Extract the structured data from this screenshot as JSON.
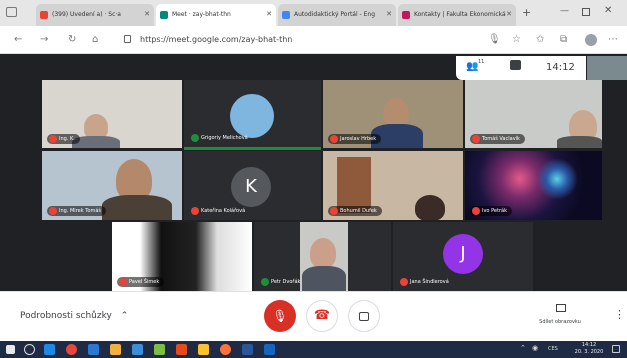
{
  "browser": {
    "tabs": [
      {
        "label": "(399) Uvedení a) · Sc·a",
        "color": "#e94335"
      },
      {
        "label": "Meet · zay-bhat-thn",
        "color": "#00897b"
      },
      {
        "label": "Autodidaktický Portál - Eng",
        "color": "#4285f4"
      },
      {
        "label": "Kontakty | Fakulta Ekonomická",
        "color": "#c2185b"
      }
    ],
    "url": "https://meet.google.com/zay-bhat-thn"
  },
  "meet": {
    "participant_count": "11",
    "clock": "14:12",
    "tiles": [
      {
        "label": "Ing. K."
      },
      {
        "label": "Grigoriy Melichová"
      },
      {
        "label": "Jaroslav Hrbek"
      },
      {
        "label": "Tomáš Vaclavík"
      },
      {
        "label": "Ing. Mirek Tomáš"
      },
      {
        "label": "Kateřina Kolářová",
        "initial": "K"
      },
      {
        "label": "Bohumil Dufek"
      },
      {
        "label": "Ivo Petrák"
      },
      {
        "label": "Pavel Šimek"
      },
      {
        "label": "Petr Dvořák"
      },
      {
        "label": "Jana Šindlerová",
        "initial": "J"
      }
    ],
    "details_label": "Podrobnosti schůzky",
    "present_label": "Sdílet obrazovku"
  },
  "taskbar": {
    "time": "14:12",
    "date": "20. 3. 2020",
    "lang": "CES"
  }
}
